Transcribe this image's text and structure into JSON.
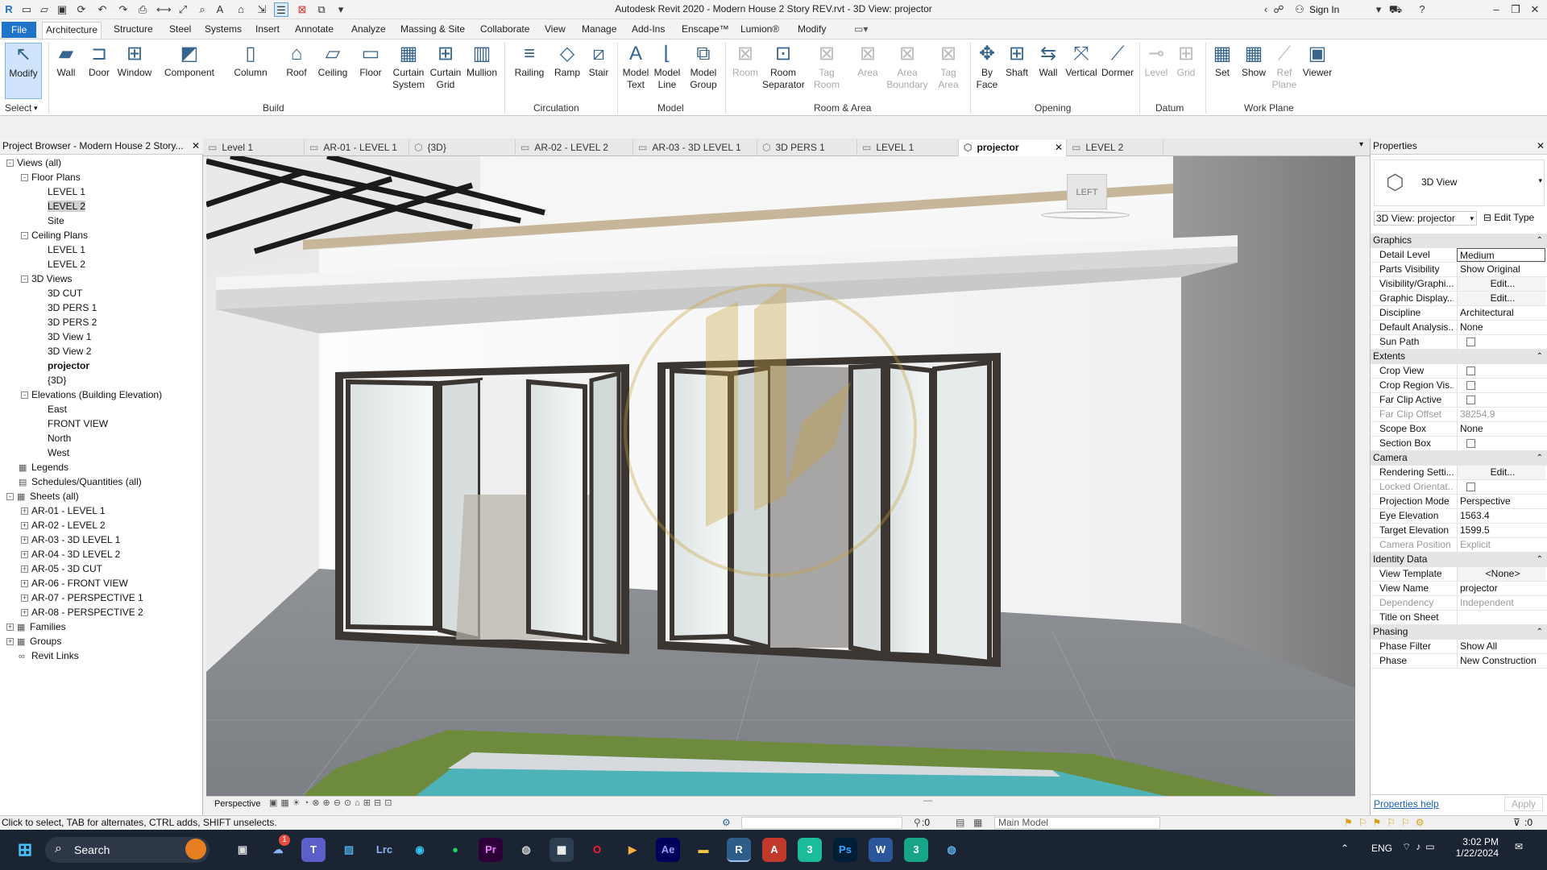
{
  "app": {
    "title": "Autodesk Revit 2020 - Modern House 2 Story REV.rvt - 3D View: projector",
    "sign_in": "Sign In"
  },
  "tabs": [
    "File",
    "Architecture",
    "Structure",
    "Steel",
    "Systems",
    "Insert",
    "Annotate",
    "Analyze",
    "Massing & Site",
    "Collaborate",
    "View",
    "Manage",
    "Add-Ins",
    "Enscape™",
    "Lumion®",
    "Modify"
  ],
  "ribbon": {
    "select": {
      "modify": "Modify",
      "label": "Select"
    },
    "build": [
      "Wall",
      "Door",
      "Window",
      "Component",
      "Column",
      "Roof",
      "Ceiling",
      "Floor",
      "Curtain System",
      "Curtain Grid",
      "Mullion"
    ],
    "build_label": "Build",
    "circulation": [
      "Railing",
      "Ramp",
      "Stair"
    ],
    "circulation_label": "Circulation",
    "model": [
      "Model Text",
      "Model Line",
      "Model Group"
    ],
    "model_label": "Model",
    "room": [
      "Room",
      "Room Separator",
      "Tag Room",
      "Area",
      "Area Boundary",
      "Tag Area"
    ],
    "room_label": "Room & Area",
    "opening": [
      "By Face",
      "Shaft",
      "Wall",
      "Vertical",
      "Dormer"
    ],
    "opening_label": "Opening",
    "datum": [
      "Level",
      "Grid"
    ],
    "datum_label": "Datum",
    "workplane": [
      "Set",
      "Show",
      "Ref Plane",
      "Viewer"
    ],
    "workplane_label": "Work Plane"
  },
  "browser": {
    "title": "Project Browser - Modern House 2 Story...",
    "nodes": [
      {
        "t": "Views (all)",
        "lvl": 0,
        "tog": "-"
      },
      {
        "t": "Floor Plans",
        "lvl": 1,
        "tog": "-"
      },
      {
        "t": "LEVEL 1",
        "lvl": 2
      },
      {
        "t": "LEVEL 2",
        "lvl": 2,
        "sel": true
      },
      {
        "t": "Site",
        "lvl": 2
      },
      {
        "t": "Ceiling Plans",
        "lvl": 1,
        "tog": "-"
      },
      {
        "t": "LEVEL 1",
        "lvl": 2
      },
      {
        "t": "LEVEL 2",
        "lvl": 2
      },
      {
        "t": "3D Views",
        "lvl": 1,
        "tog": "-"
      },
      {
        "t": "3D CUT",
        "lvl": 2
      },
      {
        "t": "3D PERS 1",
        "lvl": 2
      },
      {
        "t": "3D PERS 2",
        "lvl": 2
      },
      {
        "t": "3D View 1",
        "lvl": 2
      },
      {
        "t": "3D View 2",
        "lvl": 2
      },
      {
        "t": "projector",
        "lvl": 2,
        "bold": true
      },
      {
        "t": "{3D}",
        "lvl": 2
      },
      {
        "t": "Elevations (Building Elevation)",
        "lvl": 1,
        "tog": "-"
      },
      {
        "t": "East",
        "lvl": 2
      },
      {
        "t": "FRONT VIEW",
        "lvl": 2
      },
      {
        "t": "North",
        "lvl": 2
      },
      {
        "t": "West",
        "lvl": 2
      },
      {
        "t": "Legends",
        "lvl": 0,
        "icon": "▦"
      },
      {
        "t": "Schedules/Quantities (all)",
        "lvl": 0,
        "icon": "▤"
      },
      {
        "t": "Sheets (all)",
        "lvl": 0,
        "tog": "-",
        "icon": "▦"
      },
      {
        "t": "AR-01 - LEVEL 1",
        "lvl": 1,
        "tog": "+"
      },
      {
        "t": "AR-02 - LEVEL 2",
        "lvl": 1,
        "tog": "+"
      },
      {
        "t": "AR-03 - 3D LEVEL 1",
        "lvl": 1,
        "tog": "+"
      },
      {
        "t": "AR-04 - 3D LEVEL 2",
        "lvl": 1,
        "tog": "+"
      },
      {
        "t": "AR-05 - 3D CUT",
        "lvl": 1,
        "tog": "+"
      },
      {
        "t": "AR-06 - FRONT VIEW",
        "lvl": 1,
        "tog": "+"
      },
      {
        "t": "AR-07 - PERSPECTIVE 1",
        "lvl": 1,
        "tog": "+"
      },
      {
        "t": "AR-08 - PERSPECTIVE 2",
        "lvl": 1,
        "tog": "+"
      },
      {
        "t": "Families",
        "lvl": 0,
        "tog": "+",
        "icon": "▦"
      },
      {
        "t": "Groups",
        "lvl": 0,
        "tog": "+",
        "icon": "▦"
      },
      {
        "t": "Revit Links",
        "lvl": 0,
        "icon": "∞"
      }
    ]
  },
  "view_tabs": [
    {
      "label": "Level 1"
    },
    {
      "label": "AR-01 - LEVEL 1"
    },
    {
      "label": "{3D}"
    },
    {
      "label": "AR-02 - LEVEL 2"
    },
    {
      "label": "AR-03 - 3D LEVEL 1"
    },
    {
      "label": "3D PERS 1"
    },
    {
      "label": "LEVEL 1"
    },
    {
      "label": "projector",
      "active": true
    },
    {
      "label": "LEVEL 2"
    }
  ],
  "viewport": {
    "viewcube": "LEFT",
    "view_mode": "Perspective"
  },
  "properties": {
    "title": "Properties",
    "type": "3D View",
    "selector": "3D View: projector",
    "edit_type": "Edit Type",
    "sections": [
      {
        "name": "Graphics",
        "rows": [
          {
            "k": "Detail Level",
            "v": "Medium"
          },
          {
            "k": "Parts Visibility",
            "v": "Show Original"
          },
          {
            "k": "Visibility/Graphi...",
            "v": "Edit...",
            "btn": true
          },
          {
            "k": "Graphic Display...",
            "v": "Edit...",
            "btn": true
          },
          {
            "k": "Discipline",
            "v": "Architectural"
          },
          {
            "k": "Default Analysis...",
            "v": "None"
          },
          {
            "k": "Sun Path",
            "cb": true
          }
        ]
      },
      {
        "name": "Extents",
        "rows": [
          {
            "k": "Crop View",
            "cb": true
          },
          {
            "k": "Crop Region Vis...",
            "cb": true
          },
          {
            "k": "Far Clip Active",
            "cb": true
          },
          {
            "k": "Far Clip Offset",
            "v": "38254.9",
            "grey": true
          },
          {
            "k": "Scope Box",
            "v": "None"
          },
          {
            "k": "Section Box",
            "cb": true
          }
        ]
      },
      {
        "name": "Camera",
        "rows": [
          {
            "k": "Rendering Setti...",
            "v": "Edit...",
            "btn": true
          },
          {
            "k": "Locked Orientat...",
            "cb": true,
            "grey": true
          },
          {
            "k": "Projection Mode",
            "v": "Perspective"
          },
          {
            "k": "Eye Elevation",
            "v": "1563.4"
          },
          {
            "k": "Target Elevation",
            "v": "1599.5"
          },
          {
            "k": "Camera Position",
            "v": "Explicit",
            "grey": true
          }
        ]
      },
      {
        "name": "Identity Data",
        "rows": [
          {
            "k": "View Template",
            "v": "<None>",
            "btn": true
          },
          {
            "k": "View Name",
            "v": "projector"
          },
          {
            "k": "Dependency",
            "v": "Independent",
            "grey": true
          },
          {
            "k": "Title on Sheet",
            "v": ""
          }
        ]
      },
      {
        "name": "Phasing",
        "rows": [
          {
            "k": "Phase Filter",
            "v": "Show All"
          },
          {
            "k": "Phase",
            "v": "New Construction"
          }
        ]
      }
    ],
    "help": "Properties help",
    "apply": "Apply"
  },
  "status": {
    "hint": "Click to select, TAB for alternates, CTRL adds, SHIFT unselects.",
    "zero": ":0",
    "model": "Main Model",
    "filter": ":0"
  },
  "taskbar": {
    "search": "Search",
    "lang": "ENG",
    "time": "3:02 PM",
    "date": "1/22/2024",
    "notif": "1"
  }
}
